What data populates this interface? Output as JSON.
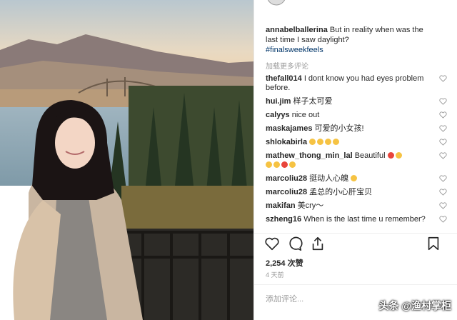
{
  "post": {
    "caption_user": "annabelballerina",
    "caption_text": "But in reality when was the last time I saw daylight?",
    "hashtag": "#finalsweekfeels",
    "load_more": "加载更多评论"
  },
  "comments": [
    {
      "user": "thefall014",
      "text": "I dont know you had eyes problem before."
    },
    {
      "user": "hui.jim",
      "text": "样子太可爱"
    },
    {
      "user": "calyys",
      "text": "nice out"
    },
    {
      "user": "maskajames",
      "text": "可爱的小女孩!"
    },
    {
      "user": "shlokabirla",
      "text": ""
    },
    {
      "user": "mathew_thong_min_lal",
      "text": "Beautiful"
    },
    {
      "user": "marcoliu28",
      "text": "挺动人心魄"
    },
    {
      "user": "marcoliu28",
      "text": "孟总的小心肝宝贝"
    },
    {
      "user": "makifan",
      "text": "美cry～"
    },
    {
      "user": "szheng16",
      "text": "When is the last time u remember?"
    }
  ],
  "likes": "2,254 次赞",
  "time_ago": "4 天前",
  "add_comment_placeholder": "添加评论...",
  "watermark": "头条 @渔村掌柜",
  "icons": {
    "like": "heart-icon",
    "comment": "comment-icon",
    "share": "share-icon",
    "save": "bookmark-icon"
  }
}
